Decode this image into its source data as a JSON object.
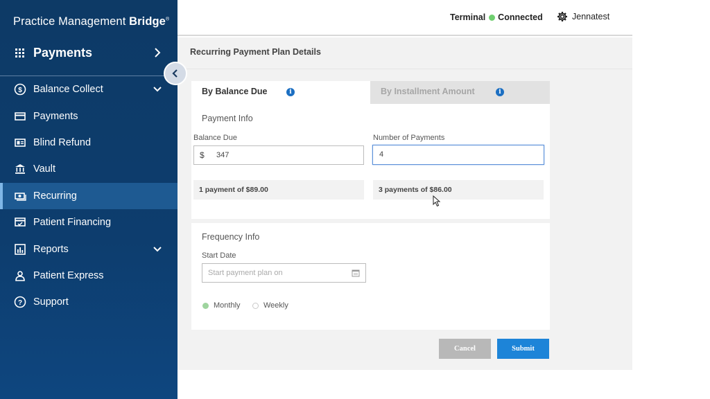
{
  "brand": {
    "name_regular": "Practice Management ",
    "name_bold": "Bridge",
    "mark": "®"
  },
  "sidebar": {
    "section_title": "Payments",
    "items": [
      {
        "label": "Balance Collect",
        "icon": "dollar-circle-icon",
        "has_chevron": true
      },
      {
        "label": "Payments",
        "icon": "card-icon"
      },
      {
        "label": "Blind Refund",
        "icon": "refund-card-icon"
      },
      {
        "label": "Vault",
        "icon": "bank-icon"
      },
      {
        "label": "Recurring",
        "icon": "cash-icon",
        "active": true
      },
      {
        "label": "Patient Financing",
        "icon": "financing-card-icon"
      },
      {
        "label": "Reports",
        "icon": "bar-chart-icon",
        "has_chevron": true
      },
      {
        "label": "Patient Express",
        "icon": "person-icon"
      },
      {
        "label": "Support",
        "icon": "help-circle-icon"
      }
    ]
  },
  "topbar": {
    "terminal_label": "Terminal",
    "terminal_status": "Connected",
    "username": "Jennatest"
  },
  "page": {
    "title": "Recurring Payment Plan Details",
    "tabs": [
      {
        "label": "By Balance Due",
        "active": true
      },
      {
        "label": "By Installment Amount",
        "active": false
      }
    ],
    "payment_info": {
      "title": "Payment Info",
      "balance_due_label": "Balance Due",
      "currency_symbol": "$",
      "balance_due_value": "347",
      "num_payments_label": "Number of Payments",
      "num_payments_value": "4",
      "summary_1": "1 payment of $89.00",
      "summary_2": "3 payments of $86.00"
    },
    "frequency_info": {
      "title": "Frequency Info",
      "start_date_label": "Start Date",
      "start_date_placeholder": "Start payment plan on",
      "options": [
        "Monthly",
        "Weekly"
      ],
      "selected": "Monthly"
    },
    "buttons": {
      "cancel": "Cancel",
      "submit": "Submit"
    }
  },
  "colors": {
    "sidebar_bg": "#0d3d6e",
    "active_item": "#1e5a92",
    "status_dot": "#6fcf6f",
    "submit": "#1d84d8",
    "info_icon": "#1c6fc2"
  }
}
